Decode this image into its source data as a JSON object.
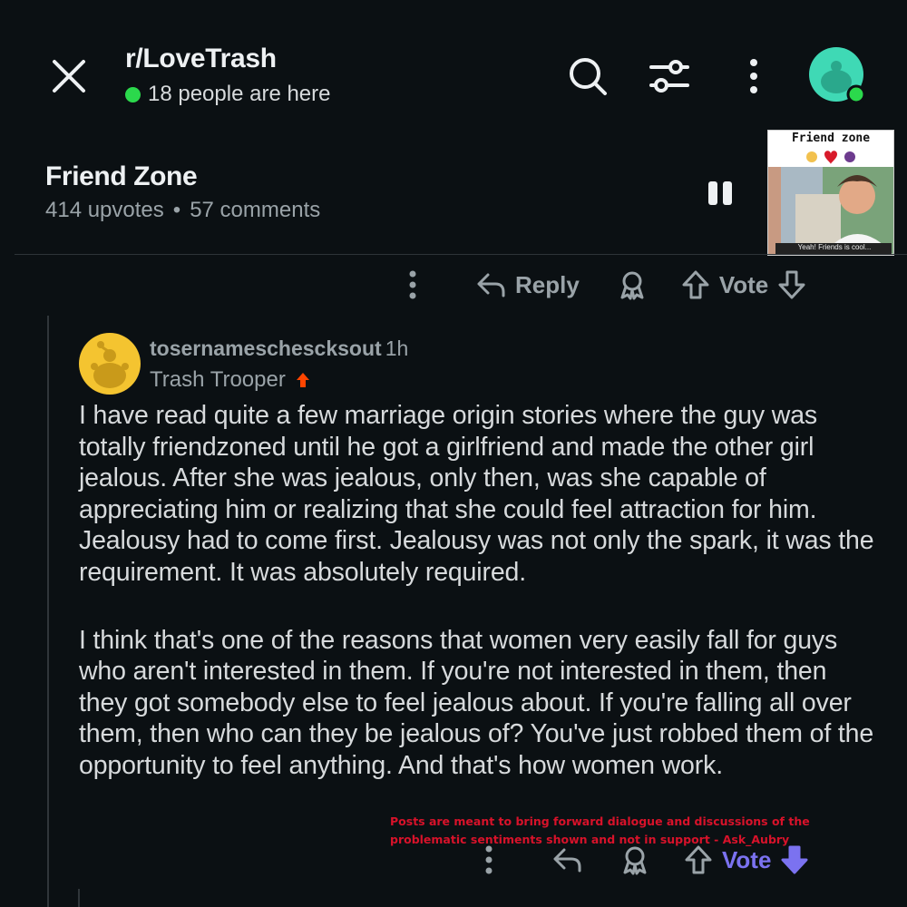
{
  "header": {
    "subreddit": "r/LoveTrash",
    "online": "18 people are here"
  },
  "post": {
    "title": "Friend Zone",
    "upvotes": "414 upvotes",
    "separator": "•",
    "comments": "57 comments",
    "thumbnail": {
      "caption_top": "Friend zone",
      "caption_bottom": "Yeah! Friends is cool..."
    }
  },
  "actions": {
    "reply": "Reply",
    "vote": "Vote"
  },
  "comment": {
    "username": "tosernameschescksout",
    "time": "1h",
    "flair": "Trash Trooper",
    "paragraphs": [
      "I have read quite a few marriage origin stories where the guy was totally friendzoned until he got a girlfriend and made the other girl jealous. After she was jealous, only then, was she capable of appreciating him or realizing that she could feel attraction for him. Jealousy had to come first. Jealousy was not only the spark, it was the requirement. It was absolutely required.",
      "I think that's one of the reasons that women very easily fall for guys who aren't interested in them. If you're not interested in them, then they got somebody else to feel jealous about. If you're falling all over them, then who can they be jealous of? You've just robbed them of the opportunity to feel anything. And that's how women work."
    ]
  },
  "overlay_note": "Posts are meant to bring forward dialogue and discussions of the problematic sentiments shown and not in support - Ask_Aubry",
  "colors": {
    "background": "#0b1013",
    "online_dot": "#2bd94c",
    "avatar_teal": "#3fd9b5",
    "comment_avatar": "#f4c430",
    "flair_arrow": "#ff4500",
    "vote_active": "#7b72f0",
    "overlay_text": "#d8122a"
  },
  "icons": [
    "close-icon",
    "search-icon",
    "filter-icon",
    "more-vertical-icon",
    "snoo-avatar-icon",
    "pause-icon",
    "reply-arrow-icon",
    "award-icon",
    "upvote-icon",
    "downvote-icon"
  ]
}
